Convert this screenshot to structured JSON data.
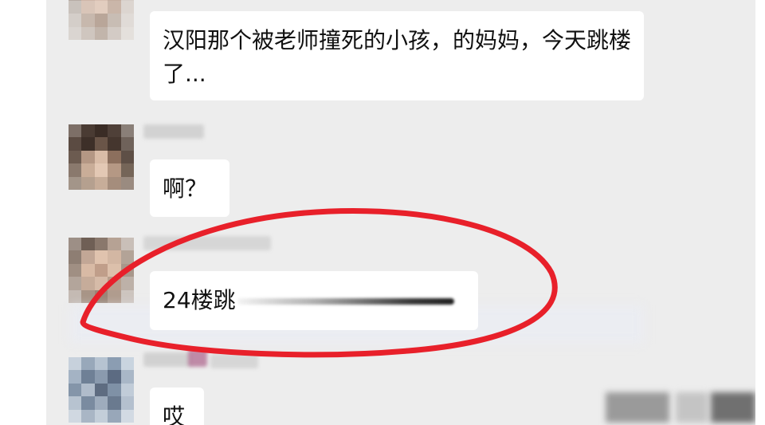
{
  "messages": [
    {
      "text": "汉阳那个被老师撞死的小孩，的妈妈，今天跳楼了..."
    },
    {
      "text": "啊？"
    },
    {
      "text": "24楼跳",
      "censored": true
    },
    {
      "text": "哎"
    }
  ],
  "colors": {
    "background": "#ededed",
    "bubble": "#ffffff",
    "annotation_circle": "#e8202a"
  },
  "icons": [
    "avatar",
    "annotation-circle"
  ]
}
